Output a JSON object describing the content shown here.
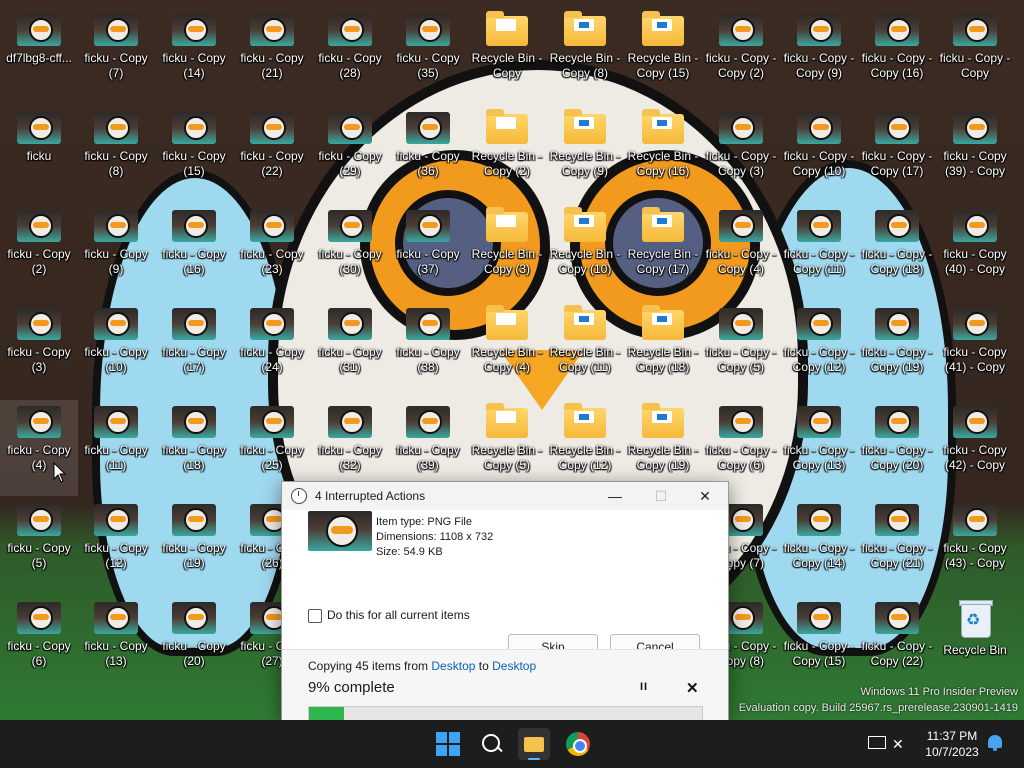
{
  "desktop": {
    "columns": [
      [
        "df7lbg8-cff...",
        "ficku",
        "ficku - Copy (2)",
        "ficku - Copy (3)",
        "ficku - Copy (4)",
        "ficku - Copy (5)",
        "ficku - Copy (6)"
      ],
      [
        "ficku - Copy (7)",
        "ficku - Copy (8)",
        "ficku - Copy (9)",
        "ficku - Copy (10)",
        "ficku - Copy (11)",
        "ficku - Copy (12)",
        "ficku - Copy (13)"
      ],
      [
        "ficku - Copy (14)",
        "ficku - Copy (15)",
        "ficku - Copy (16)",
        "ficku - Copy (17)",
        "ficku - Copy (18)",
        "ficku - Copy (19)",
        "ficku - Copy (20)"
      ],
      [
        "ficku - Copy (21)",
        "ficku - Copy (22)",
        "ficku - Copy (23)",
        "ficku - Copy (24)",
        "ficku - Copy (25)",
        "ficku - Copy (26)",
        "ficku - Copy (27)"
      ],
      [
        "ficku - Copy (28)",
        "ficku - Copy (29)",
        "ficku - Copy (30)",
        "ficku - Copy (31)",
        "ficku - Copy (32)"
      ],
      [
        "ficku - Copy (35)",
        "ficku - Copy (36)",
        "ficku - Copy (37)",
        "ficku - Copy (38)",
        "ficku - Copy (39)"
      ],
      [
        "Recycle Bin - Copy",
        "Recycle Bin - Copy (2)",
        "Recycle Bin - Copy (3)",
        "Recycle Bin - Copy (4)",
        "Recycle Bin - Copy (5)"
      ],
      [
        "Recycle Bin - Copy (8)",
        "Recycle Bin - Copy (9)",
        "Recycle Bin - Copy (10)",
        "Recycle Bin - Copy (11)",
        "Recycle Bin - Copy (12)"
      ],
      [
        "Recycle Bin - Copy (15)",
        "Recycle Bin - Copy (16)",
        "Recycle Bin - Copy (17)",
        "Recycle Bin - Copy (18)",
        "Recycle Bin - Copy (19)"
      ],
      [
        "ficku - Copy - Copy (2)",
        "ficku - Copy - Copy (3)",
        "ficku - Copy - Copy (4)",
        "ficku - Copy - Copy (5)",
        "ficku - Copy - Copy (6)",
        "ficku - Copy - Copy (7)",
        "ficku - Copy - Copy (8)"
      ],
      [
        "ficku - Copy - Copy (9)",
        "ficku - Copy - Copy (10)",
        "ficku - Copy - Copy (11)",
        "ficku - Copy - Copy (12)",
        "ficku - Copy - Copy (13)",
        "ficku - Copy - Copy (14)",
        "ficku - Copy - Copy (15)"
      ],
      [
        "ficku - Copy - Copy (16)",
        "ficku - Copy - Copy (17)",
        "ficku - Copy - Copy (18)",
        "ficku - Copy - Copy (19)",
        "ficku - Copy - Copy (20)",
        "ficku - Copy - Copy (21)",
        "ficku - Copy - Copy (22)"
      ],
      [
        "ficku - Copy - Copy",
        "ficku - Copy (39) - Copy",
        "ficku - Copy (40) - Copy",
        "ficku - Copy (41) - Copy",
        "ficku - Copy (42) - Copy",
        "ficku - Copy (43) - Copy",
        "Recycle Bin"
      ]
    ],
    "watermark_line1": "Windows 11 Pro Insider Preview",
    "watermark_line2": "Evaluation copy. Build 25967.rs_prerelease.230901-1419"
  },
  "dialog": {
    "title": "4 Interrupted Actions",
    "item_type": "Item type: PNG File",
    "dimensions": "Dimensions: 1108 x 732",
    "size": "Size: 54.9 KB",
    "checkbox_label": "Do this for all current items",
    "checkbox_checked": false,
    "skip_label": "Skip",
    "cancel_label": "Cancel",
    "copy_prefix": "Copying 45 items from",
    "copy_from": "Desktop",
    "copy_mid": "to",
    "copy_to": "Desktop",
    "percent_text": "9% complete",
    "progress": 0.09,
    "minimize": "—",
    "maximize": "☐",
    "close": "✕",
    "pause": "II",
    "stop": "✕"
  },
  "taskbar": {
    "clock_time": "11:37 PM",
    "clock_date": "10/7/2023",
    "tray_network_icon": "✕"
  },
  "colors": {
    "accent": "#3da5f4",
    "progress": "#2fb64d",
    "link": "#0a62b8",
    "taskbar": "#1d1d1d"
  }
}
